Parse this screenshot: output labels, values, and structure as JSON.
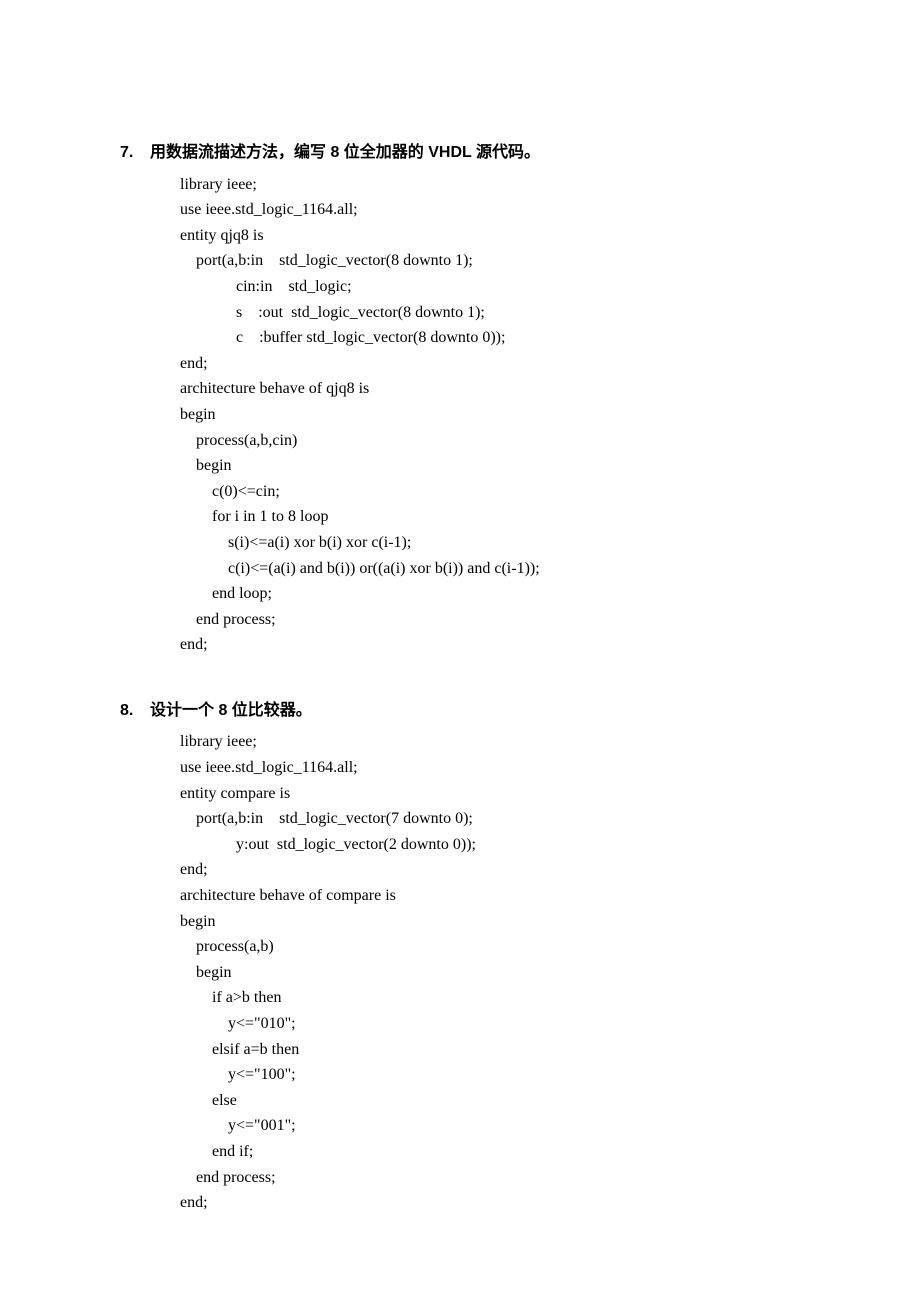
{
  "sections": [
    {
      "number": "7.",
      "title": "用数据流描述方法，编写 8 位全加器的 VHDL 源代码。",
      "code": "library ieee;\nuse ieee.std_logic_1164.all;\nentity qjq8 is\n    port(a,b:in    std_logic_vector(8 downto 1);\n              cin:in    std_logic;\n              s    :out  std_logic_vector(8 downto 1);\n              c    :buffer std_logic_vector(8 downto 0));\nend;\narchitecture behave of qjq8 is\nbegin\n    process(a,b,cin)\n    begin\n        c(0)<=cin;\n        for i in 1 to 8 loop\n            s(i)<=a(i) xor b(i) xor c(i-1);\n            c(i)<=(a(i) and b(i)) or((a(i) xor b(i)) and c(i-1));\n        end loop;\n    end process;\nend;"
    },
    {
      "number": "8.",
      "title": "设计一个 8 位比较器。",
      "code": "library ieee;\nuse ieee.std_logic_1164.all;\nentity compare is\n    port(a,b:in    std_logic_vector(7 downto 0);\n              y:out  std_logic_vector(2 downto 0));\nend;\narchitecture behave of compare is\nbegin\n    process(a,b)\n    begin\n        if a>b then\n            y<=\"010\";\n        elsif a=b then\n            y<=\"100\";\n        else\n            y<=\"001\";\n        end if;\n    end process;\nend;"
    }
  ]
}
